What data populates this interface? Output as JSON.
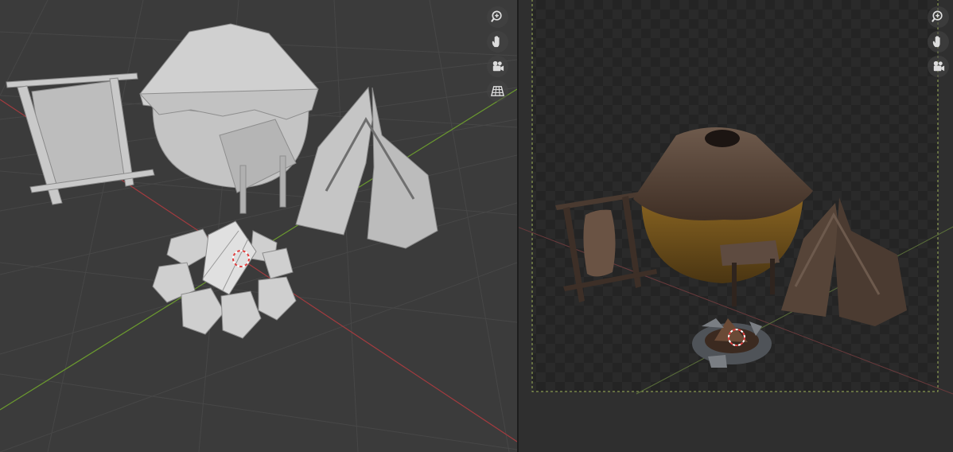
{
  "viewports": [
    {
      "id": "solid",
      "mode": "solid-shading",
      "colors": {
        "background": "#3b3b3b",
        "grid": "#474747",
        "x_axis": "#a33b3f",
        "y_axis": "#6b9a2f",
        "mesh": "#c8c8c8"
      },
      "nav_tools": [
        "zoom-icon",
        "hand-pan-icon",
        "camera-view-icon",
        "ortho-grid-icon"
      ]
    },
    {
      "id": "render",
      "mode": "rendered-preview",
      "colors": {
        "background": "#2f2f2f",
        "checker_light": "#2a2a2a",
        "checker_dark": "#222222",
        "camera_frame": "#9fb35a"
      },
      "nav_tools": [
        "zoom-icon",
        "hand-pan-icon",
        "camera-view-icon"
      ]
    }
  ],
  "scene_objects": [
    "drying-rack",
    "hut",
    "tent",
    "campfire"
  ]
}
